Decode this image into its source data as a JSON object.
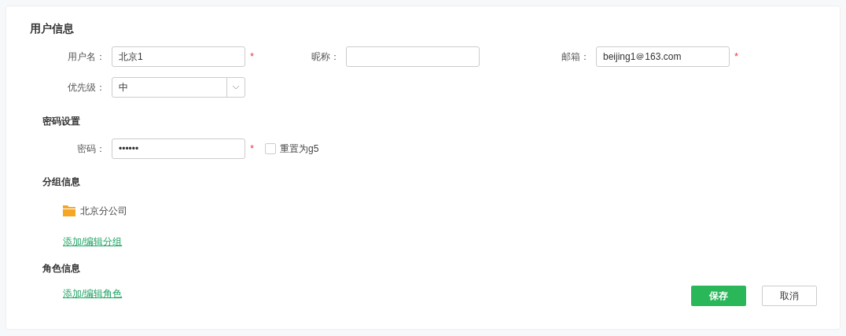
{
  "title": "用户信息",
  "fields": [
    {
      "kind": "text",
      "label": "用户名：",
      "value": "北京1",
      "required": "*"
    },
    {
      "kind": "text",
      "label": "昵称："
    },
    {
      "kind": "text",
      "label": "邮箱：",
      "value": "beijing1＠163.com",
      "required": "*"
    }
  ],
  "priority": {
    "label": "优先级：",
    "value": "中"
  },
  "password_section": {
    "title": "密码设置",
    "label": "密码：",
    "value": "••••••",
    "required": "*",
    "reset": {
      "label": "重置为g5",
      "checked": false
    }
  },
  "group_section": {
    "title": "分组信息",
    "groups": [
      "北京分公司"
    ],
    "link": "添加/编辑分组"
  },
  "role_section": {
    "title": "角色信息",
    "link": "添加/编辑角色"
  },
  "buttons": [
    {
      "kind": "primary",
      "label": "保存"
    },
    {
      "kind": "secondary",
      "label": "取消"
    }
  ]
}
